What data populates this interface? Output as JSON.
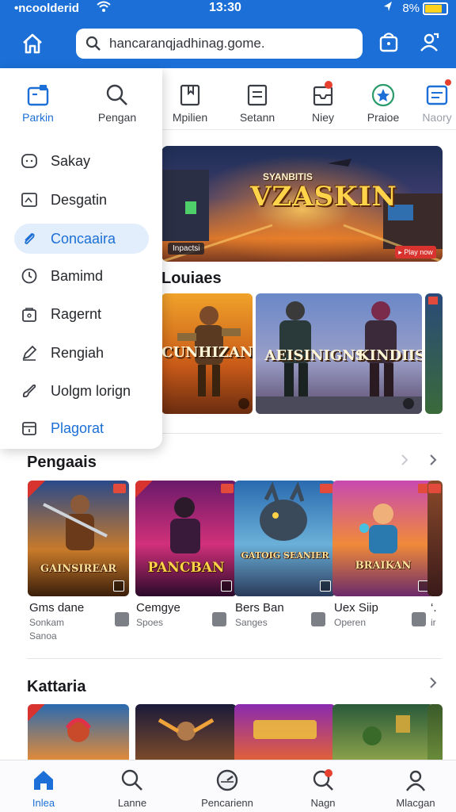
{
  "status_bar": {
    "carrier": "•ncoolderid",
    "time": "13:30",
    "battery": "8%",
    "battery_level": 0.8
  },
  "header": {
    "search_value": "hancaranqjadhinag.gome.",
    "search_placeholder": "Search"
  },
  "categories": [
    {
      "label": "Parkin",
      "icon": "wallet-icon"
    },
    {
      "label": "Pengan",
      "icon": "search-icon"
    },
    {
      "label": "Mpilien",
      "icon": "bookmark-icon"
    },
    {
      "label": "Setann",
      "icon": "document-icon"
    },
    {
      "label": "Niey",
      "icon": "inbox-icon"
    },
    {
      "label": "Praioe",
      "icon": "star-icon"
    },
    {
      "label": "Naory",
      "icon": "chat-icon"
    }
  ],
  "dropdown": {
    "items": [
      {
        "label": "Sakay",
        "icon": "face-icon"
      },
      {
        "label": "Desgatin",
        "icon": "design-icon"
      },
      {
        "label": "Concaaira",
        "icon": "paperclip-icon"
      },
      {
        "label": "Bamimd",
        "icon": "clock-icon"
      },
      {
        "label": "Ragernt",
        "icon": "bag-icon"
      },
      {
        "label": "Rengiah",
        "icon": "pen-icon"
      },
      {
        "label": "Uolgm lorign",
        "icon": "brush-icon"
      },
      {
        "label": "Plagorat",
        "icon": "calendar-icon"
      }
    ]
  },
  "hero": {
    "title": "VZASKIN",
    "subtitle": "SYANBITIS",
    "tag": "Inpactsi",
    "cta": "▸ Play now"
  },
  "featured": {
    "title": "Louiaes",
    "cards": [
      {
        "name": "CUNHIZAN"
      },
      {
        "name": "AEISINIGNS"
      },
      {
        "name": "KINDIIS"
      }
    ]
  },
  "section1": {
    "title": "Pengaais",
    "games": [
      {
        "logo": "GAINSIREAR",
        "name": "Gms dane",
        "line1": "Sonkam",
        "line2": "Sanoa"
      },
      {
        "logo": "PANCBAN",
        "name": "Cemgye",
        "line1": "Spoes",
        "line2": ""
      },
      {
        "logo": "GATOIG SEANIER",
        "name": "Bers Ban",
        "line1": "Sanges",
        "line2": ""
      },
      {
        "logo": "BRAIKAN",
        "name": "Uex Siip",
        "line1": "Operen",
        "line2": ""
      },
      {
        "logo": "",
        "name": "‘.",
        "line1": "ir",
        "line2": ""
      }
    ]
  },
  "section2": {
    "title": "Kattaria"
  },
  "bottom_nav": [
    {
      "label": "Inlea",
      "icon": "home-icon"
    },
    {
      "label": "Lanne",
      "icon": "search-icon"
    },
    {
      "label": "Pencarienn",
      "icon": "gauge-icon"
    },
    {
      "label": "Nagn",
      "icon": "notification-icon"
    },
    {
      "label": "Mlacgan",
      "icon": "profile-icon"
    }
  ],
  "colors": {
    "accent": "#1b6fd6",
    "header_bg": "#1b6fd6",
    "badge": "#e8402f"
  }
}
